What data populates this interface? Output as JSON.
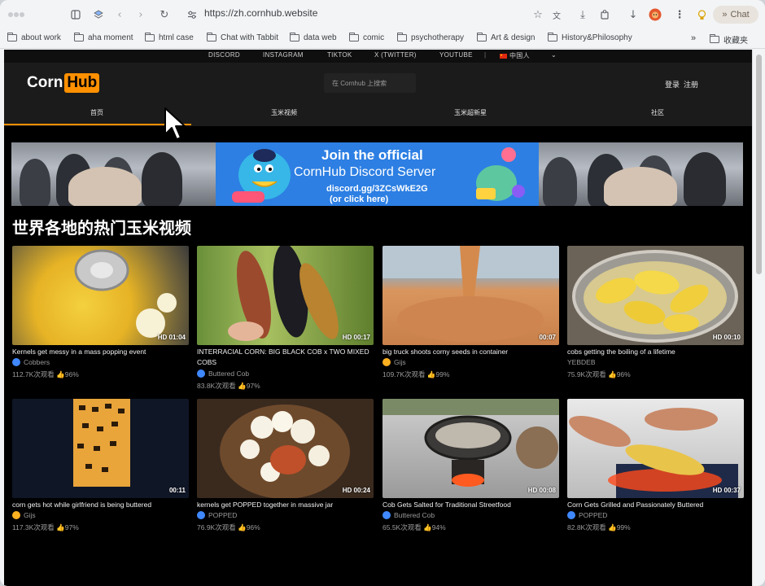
{
  "browser": {
    "url": "https://zh.cornhub.website",
    "chat_label": "Chat",
    "bookmarks": [
      "about work",
      "aha moment",
      "html case",
      "Chat with Tabbit",
      "data web",
      "comic",
      "psychotherapy",
      "Art & design",
      "History&Philosophy"
    ],
    "overflow_label": "»",
    "favorites_label": "收藏夹"
  },
  "site": {
    "social_links": [
      "DISCORD",
      "INSTAGRAM",
      "TIKTOK",
      "X (TWITTER)",
      "YOUTUBE"
    ],
    "language": "中国人",
    "logo_left": "Corn",
    "logo_right": "Hub",
    "search_placeholder": "在 Cornhub 上搜索",
    "login": "登录",
    "register": "注册",
    "nav": [
      "首页",
      "玉米视频",
      "玉米超新星",
      "社区"
    ],
    "banner": {
      "line1": "Join the official",
      "line2": "CornHub Discord Server",
      "line3": "discord.gg/3ZCsWkE2G",
      "line4": "(or click here)"
    },
    "section_title": "世界各地的热门玉米视频"
  },
  "videos": [
    {
      "title": "Kernels get messy in a mass popping event",
      "channel": "Cobbers",
      "badge": "blue",
      "duration": "HD 01:04",
      "views": "112.7K次观看",
      "rating": "96%"
    },
    {
      "title": "INTERRACIAL CORN: BIG BLACK COB x TWO MIXED COBS",
      "channel": "Buttered Cob",
      "badge": "blue",
      "duration": "HD 00:17",
      "views": "83.8K次观看",
      "rating": "97%"
    },
    {
      "title": "big truck shoots corny seeds in container",
      "channel": "Gijs",
      "badge": "orange",
      "duration": "00:07",
      "views": "109.7K次观看",
      "rating": "99%"
    },
    {
      "title": "cobs getting the boiling of a lifetime",
      "channel": "YEBDEB",
      "badge": "none",
      "duration": "HD 00:10",
      "views": "75.9K次观看",
      "rating": "96%"
    },
    {
      "title": "corn gets hot while girlfriend is being buttered",
      "channel": "Gijs",
      "badge": "orange",
      "duration": "00:11",
      "views": "117.3K次观看",
      "rating": "97%"
    },
    {
      "title": "kernels get POPPED together in massive jar",
      "channel": "POPPED",
      "badge": "blue",
      "duration": "HD 00:24",
      "views": "76.9K次观看",
      "rating": "96%"
    },
    {
      "title": "Cob Gets Salted for Traditional Streetfood",
      "channel": "Buttered Cob",
      "badge": "blue",
      "duration": "HD 00:08",
      "views": "65.5K次观看",
      "rating": "94%"
    },
    {
      "title": "Corn Gets Grilled and Passionately Buttered",
      "channel": "POPPED",
      "badge": "blue",
      "duration": "HD 00:37",
      "views": "82.8K次观看",
      "rating": "99%"
    }
  ],
  "colors": {
    "accent": "#ff9000",
    "page_bg": "#000000",
    "header_bg": "#1b1b1b",
    "banner_blue": "#2d7fe3"
  }
}
